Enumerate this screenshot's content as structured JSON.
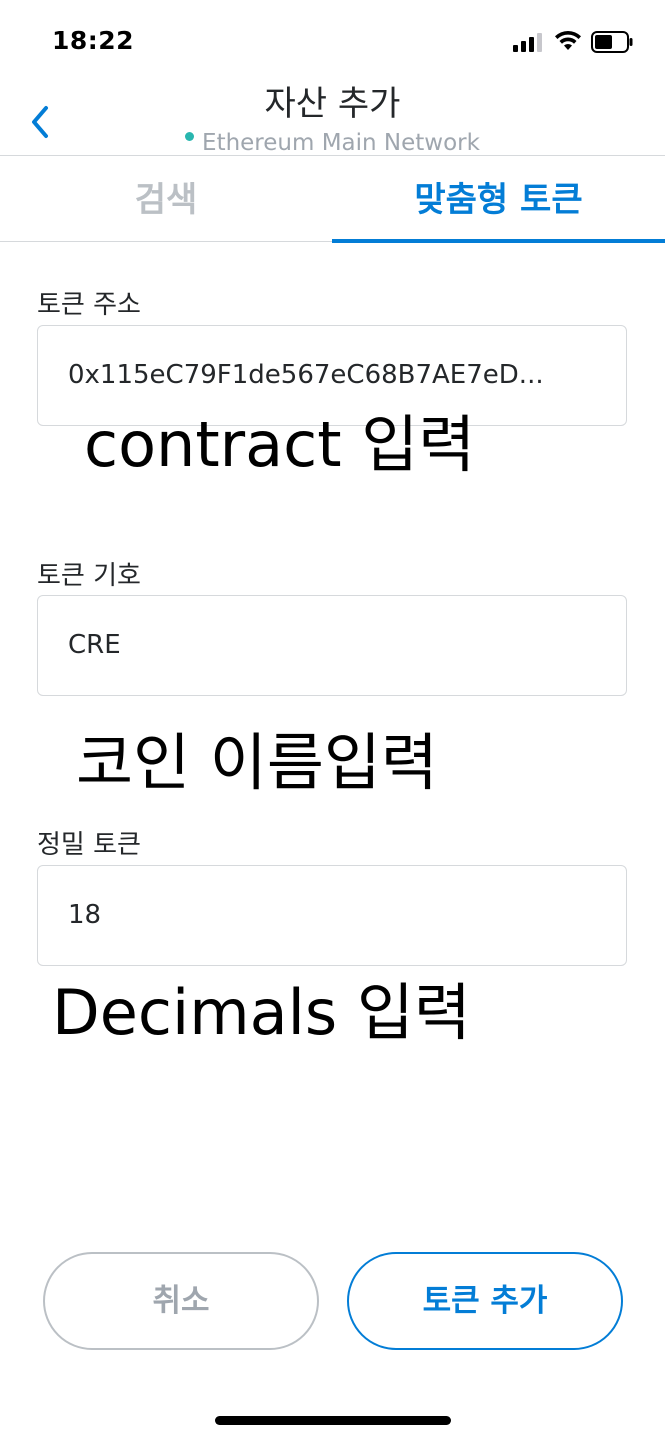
{
  "status_bar": {
    "time": "18:22",
    "icons": [
      "cellular-signal-icon",
      "wifi-icon",
      "battery-icon"
    ]
  },
  "header": {
    "title": "자산 추가",
    "network": "Ethereum Main Network",
    "network_dot_color": "#29b6af",
    "back_icon": "chevron-left-icon"
  },
  "tabs": [
    {
      "label": "검색",
      "active": false
    },
    {
      "label": "맞춤형 토큰",
      "active": true
    }
  ],
  "form": {
    "token_address": {
      "label": "토큰 주소",
      "value": "0x115eC79F1de567eC68B7AE7eD..."
    },
    "token_symbol": {
      "label": "토큰 기호",
      "value": "CRE"
    },
    "token_decimals": {
      "label": "정밀 토큰",
      "value": "18"
    }
  },
  "annotations": {
    "address_hint": "contract 입력",
    "symbol_hint": "코인 이름입력",
    "decimals_hint": "Decimals 입력"
  },
  "buttons": {
    "cancel": "취소",
    "add_token": "토큰 추가"
  },
  "colors": {
    "accent": "#037dd6",
    "muted": "#bbc0c5",
    "text": "#24272a"
  }
}
